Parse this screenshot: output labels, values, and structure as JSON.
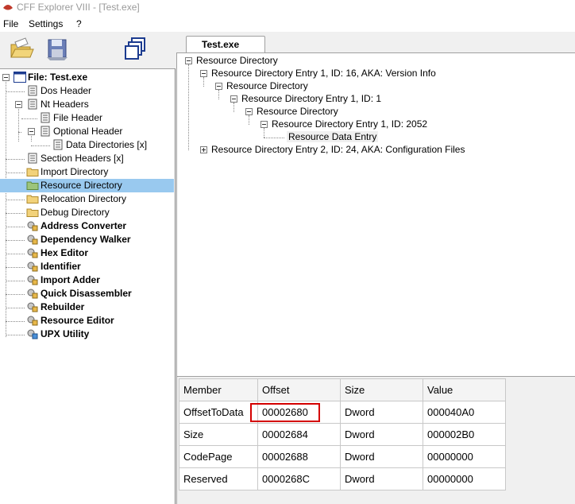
{
  "window": {
    "title": "CFF Explorer VIII - [Test.exe]"
  },
  "menu": {
    "file": "File",
    "settings": "Settings",
    "help": "?"
  },
  "tabs": [
    {
      "label": "Test.exe"
    }
  ],
  "left_tree": {
    "root": "File: Test.exe",
    "items": [
      {
        "label": "Dos Header",
        "icon": "document-icon"
      },
      {
        "label": "Nt Headers",
        "icon": "document-icon"
      },
      {
        "label": "File Header",
        "icon": "document-icon"
      },
      {
        "label": "Optional Header",
        "icon": "document-icon"
      },
      {
        "label": "Data Directories [x]",
        "icon": "document-icon"
      },
      {
        "label": "Section Headers [x]",
        "icon": "document-icon"
      },
      {
        "label": "Import Directory",
        "icon": "folder-icon"
      },
      {
        "label": "Resource Directory",
        "icon": "folder-icon"
      },
      {
        "label": "Relocation Directory",
        "icon": "folder-icon"
      },
      {
        "label": "Debug Directory",
        "icon": "folder-icon"
      },
      {
        "label": "Address Converter",
        "icon": "tool-icon"
      },
      {
        "label": "Dependency Walker",
        "icon": "tool-icon"
      },
      {
        "label": "Hex Editor",
        "icon": "tool-icon"
      },
      {
        "label": "Identifier",
        "icon": "tool-icon"
      },
      {
        "label": "Import Adder",
        "icon": "tool-icon"
      },
      {
        "label": "Quick Disassembler",
        "icon": "tool-icon"
      },
      {
        "label": "Rebuilder",
        "icon": "tool-icon"
      },
      {
        "label": "Resource Editor",
        "icon": "tool-icon"
      },
      {
        "label": "UPX Utility",
        "icon": "upx-tool-icon"
      }
    ]
  },
  "resource_tree": [
    "Resource Directory",
    "Resource Directory Entry 1, ID: 16, AKA: Version Info",
    "Resource Directory",
    "Resource Directory Entry 1, ID: 1",
    "Resource Directory",
    "Resource Directory Entry 1, ID: 2052",
    "Resource Data Entry",
    "Resource Directory Entry 2, ID: 24, AKA: Configuration Files"
  ],
  "grid": {
    "headers": [
      "Member",
      "Offset",
      "Size",
      "Value"
    ],
    "rows": [
      [
        "OffsetToData",
        "00002680",
        "Dword",
        "000040A0"
      ],
      [
        "Size",
        "00002684",
        "Dword",
        "000002B0"
      ],
      [
        "CodePage",
        "00002688",
        "Dword",
        "00000000"
      ],
      [
        "Reserved",
        "0000268C",
        "Dword",
        "00000000"
      ]
    ]
  },
  "colors": {
    "selection": "#99c9ef",
    "highlight_box": "#d40000"
  }
}
